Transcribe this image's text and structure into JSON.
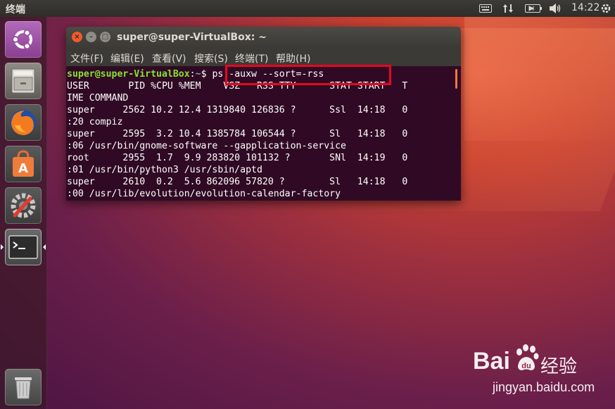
{
  "top_panel": {
    "title": "终端",
    "clock": "14:22",
    "icons": [
      "keyboard-icon",
      "network-updown-icon",
      "battery-icon",
      "volume-icon",
      "power-gear-icon"
    ]
  },
  "launcher": {
    "items": [
      {
        "name": "ubuntu-dash",
        "icon": "ubuntu-logo-icon"
      },
      {
        "name": "files",
        "icon": "file-cabinet-icon"
      },
      {
        "name": "firefox",
        "icon": "firefox-icon"
      },
      {
        "name": "software-center",
        "icon": "shopping-bag-icon"
      },
      {
        "name": "system-settings",
        "icon": "settings-wrench-icon"
      },
      {
        "name": "terminal",
        "icon": "terminal-icon"
      },
      {
        "name": "trash",
        "icon": "trash-icon"
      }
    ]
  },
  "terminal": {
    "title": "super@super-VirtualBox: ~",
    "menu": [
      "文件(F)",
      "编辑(E)",
      "查看(V)",
      "搜索(S)",
      "终端(T)",
      "帮助(H)"
    ],
    "prompt_user": "super@super-VirtualBox",
    "prompt_sep": ":",
    "prompt_path": "~",
    "prompt_dollar": "$ ",
    "command": "ps -auxw --sort=-rss",
    "lines": [
      "USER       PID %CPU %MEM    VSZ   RSS TTY      STAT START   T",
      "IME COMMAND",
      "super     2562 10.2 12.4 1319840 126836 ?      Ssl  14:18   0",
      ":20 compiz",
      "super     2595  3.2 10.4 1385784 106544 ?      Sl   14:18   0",
      ":06 /usr/bin/gnome-software --gapplication-service",
      "root      2955  1.7  9.9 283820 101132 ?       SNl  14:19   0",
      ":01 /usr/bin/python3 /usr/sbin/aptd",
      "super     2610  0.2  5.6 862096 57820 ?        Sl   14:18   0",
      ":00 /usr/lib/evolution/evolution-calendar-factory"
    ]
  },
  "watermark": {
    "brand_left": "Bai",
    "brand_right": "经验",
    "url": "jingyan.baidu.com"
  },
  "colors": {
    "terminal_bg": "#300a24",
    "prompt_user": "#8ae234",
    "prompt_path": "#729fcf",
    "highlight": "#e8071f"
  }
}
